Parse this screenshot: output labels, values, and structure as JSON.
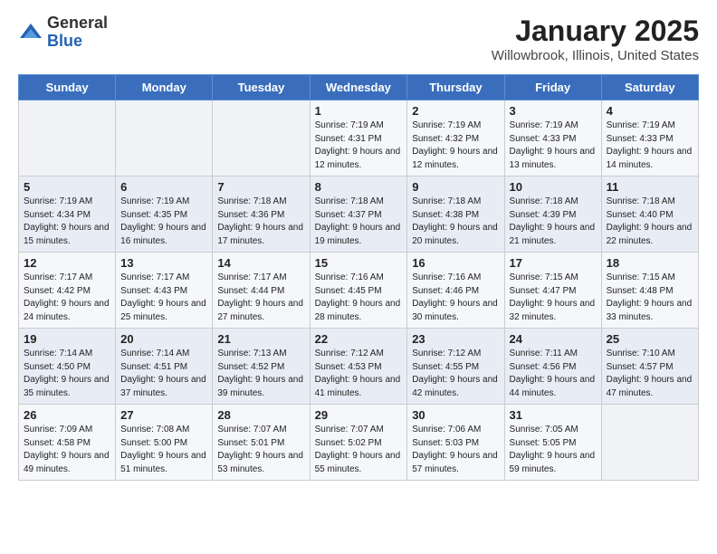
{
  "header": {
    "logo_general": "General",
    "logo_blue": "Blue",
    "title": "January 2025",
    "subtitle": "Willowbrook, Illinois, United States"
  },
  "days_of_week": [
    "Sunday",
    "Monday",
    "Tuesday",
    "Wednesday",
    "Thursday",
    "Friday",
    "Saturday"
  ],
  "weeks": [
    [
      {
        "day": "",
        "info": ""
      },
      {
        "day": "",
        "info": ""
      },
      {
        "day": "",
        "info": ""
      },
      {
        "day": "1",
        "info": "Sunrise: 7:19 AM\nSunset: 4:31 PM\nDaylight: 9 hours\nand 12 minutes."
      },
      {
        "day": "2",
        "info": "Sunrise: 7:19 AM\nSunset: 4:32 PM\nDaylight: 9 hours\nand 12 minutes."
      },
      {
        "day": "3",
        "info": "Sunrise: 7:19 AM\nSunset: 4:33 PM\nDaylight: 9 hours\nand 13 minutes."
      },
      {
        "day": "4",
        "info": "Sunrise: 7:19 AM\nSunset: 4:33 PM\nDaylight: 9 hours\nand 14 minutes."
      }
    ],
    [
      {
        "day": "5",
        "info": "Sunrise: 7:19 AM\nSunset: 4:34 PM\nDaylight: 9 hours\nand 15 minutes."
      },
      {
        "day": "6",
        "info": "Sunrise: 7:19 AM\nSunset: 4:35 PM\nDaylight: 9 hours\nand 16 minutes."
      },
      {
        "day": "7",
        "info": "Sunrise: 7:18 AM\nSunset: 4:36 PM\nDaylight: 9 hours\nand 17 minutes."
      },
      {
        "day": "8",
        "info": "Sunrise: 7:18 AM\nSunset: 4:37 PM\nDaylight: 9 hours\nand 19 minutes."
      },
      {
        "day": "9",
        "info": "Sunrise: 7:18 AM\nSunset: 4:38 PM\nDaylight: 9 hours\nand 20 minutes."
      },
      {
        "day": "10",
        "info": "Sunrise: 7:18 AM\nSunset: 4:39 PM\nDaylight: 9 hours\nand 21 minutes."
      },
      {
        "day": "11",
        "info": "Sunrise: 7:18 AM\nSunset: 4:40 PM\nDaylight: 9 hours\nand 22 minutes."
      }
    ],
    [
      {
        "day": "12",
        "info": "Sunrise: 7:17 AM\nSunset: 4:42 PM\nDaylight: 9 hours\nand 24 minutes."
      },
      {
        "day": "13",
        "info": "Sunrise: 7:17 AM\nSunset: 4:43 PM\nDaylight: 9 hours\nand 25 minutes."
      },
      {
        "day": "14",
        "info": "Sunrise: 7:17 AM\nSunset: 4:44 PM\nDaylight: 9 hours\nand 27 minutes."
      },
      {
        "day": "15",
        "info": "Sunrise: 7:16 AM\nSunset: 4:45 PM\nDaylight: 9 hours\nand 28 minutes."
      },
      {
        "day": "16",
        "info": "Sunrise: 7:16 AM\nSunset: 4:46 PM\nDaylight: 9 hours\nand 30 minutes."
      },
      {
        "day": "17",
        "info": "Sunrise: 7:15 AM\nSunset: 4:47 PM\nDaylight: 9 hours\nand 32 minutes."
      },
      {
        "day": "18",
        "info": "Sunrise: 7:15 AM\nSunset: 4:48 PM\nDaylight: 9 hours\nand 33 minutes."
      }
    ],
    [
      {
        "day": "19",
        "info": "Sunrise: 7:14 AM\nSunset: 4:50 PM\nDaylight: 9 hours\nand 35 minutes."
      },
      {
        "day": "20",
        "info": "Sunrise: 7:14 AM\nSunset: 4:51 PM\nDaylight: 9 hours\nand 37 minutes."
      },
      {
        "day": "21",
        "info": "Sunrise: 7:13 AM\nSunset: 4:52 PM\nDaylight: 9 hours\nand 39 minutes."
      },
      {
        "day": "22",
        "info": "Sunrise: 7:12 AM\nSunset: 4:53 PM\nDaylight: 9 hours\nand 41 minutes."
      },
      {
        "day": "23",
        "info": "Sunrise: 7:12 AM\nSunset: 4:55 PM\nDaylight: 9 hours\nand 42 minutes."
      },
      {
        "day": "24",
        "info": "Sunrise: 7:11 AM\nSunset: 4:56 PM\nDaylight: 9 hours\nand 44 minutes."
      },
      {
        "day": "25",
        "info": "Sunrise: 7:10 AM\nSunset: 4:57 PM\nDaylight: 9 hours\nand 47 minutes."
      }
    ],
    [
      {
        "day": "26",
        "info": "Sunrise: 7:09 AM\nSunset: 4:58 PM\nDaylight: 9 hours\nand 49 minutes."
      },
      {
        "day": "27",
        "info": "Sunrise: 7:08 AM\nSunset: 5:00 PM\nDaylight: 9 hours\nand 51 minutes."
      },
      {
        "day": "28",
        "info": "Sunrise: 7:07 AM\nSunset: 5:01 PM\nDaylight: 9 hours\nand 53 minutes."
      },
      {
        "day": "29",
        "info": "Sunrise: 7:07 AM\nSunset: 5:02 PM\nDaylight: 9 hours\nand 55 minutes."
      },
      {
        "day": "30",
        "info": "Sunrise: 7:06 AM\nSunset: 5:03 PM\nDaylight: 9 hours\nand 57 minutes."
      },
      {
        "day": "31",
        "info": "Sunrise: 7:05 AM\nSunset: 5:05 PM\nDaylight: 9 hours\nand 59 minutes."
      },
      {
        "day": "",
        "info": ""
      }
    ]
  ]
}
